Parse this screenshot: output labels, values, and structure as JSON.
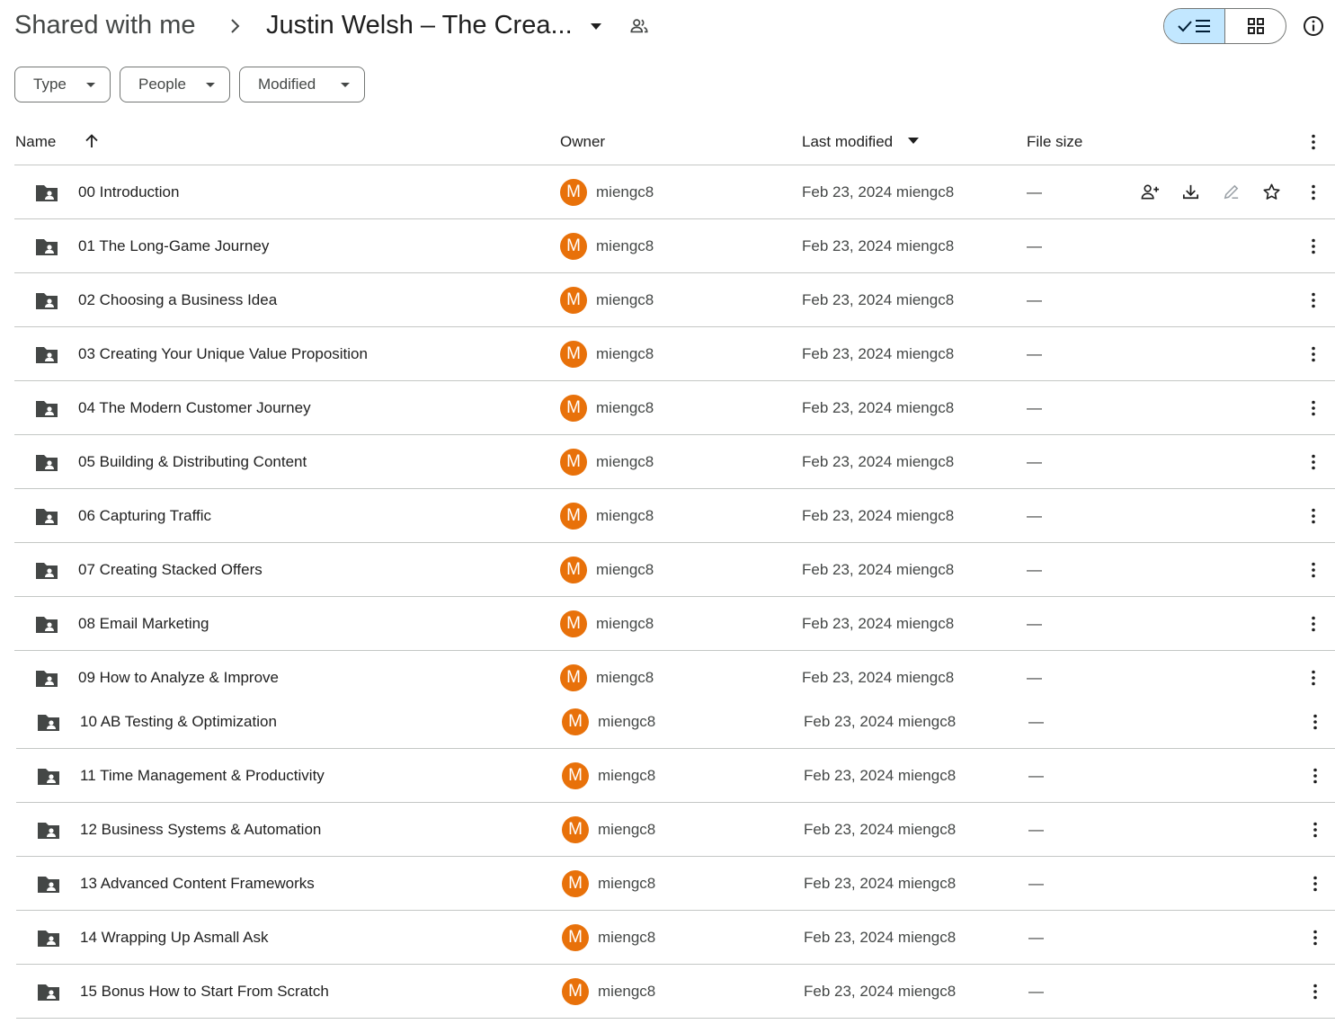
{
  "breadcrumb": {
    "root": "Shared with me",
    "current": "Justin Welsh – The Crea..."
  },
  "filters": [
    {
      "label": "Type"
    },
    {
      "label": "People"
    },
    {
      "label": "Modified"
    }
  ],
  "columns": {
    "name": "Name",
    "owner": "Owner",
    "last_modified": "Last modified",
    "file_size": "File size"
  },
  "accent": {
    "avatar": "#e8710a",
    "selected_view": "#c2e7ff"
  },
  "rows": [
    {
      "name": "00 Introduction",
      "avatar": "M",
      "owner": "miengc8",
      "modified": "Feb 23, 2024 miengc8",
      "size": "—"
    },
    {
      "name": "01 The Long-Game Journey",
      "avatar": "M",
      "owner": "miengc8",
      "modified": "Feb 23, 2024 miengc8",
      "size": "—"
    },
    {
      "name": "02 Choosing a Business Idea",
      "avatar": "M",
      "owner": "miengc8",
      "modified": "Feb 23, 2024 miengc8",
      "size": "—"
    },
    {
      "name": "03 Creating Your Unique Value Proposition",
      "avatar": "M",
      "owner": "miengc8",
      "modified": "Feb 23, 2024 miengc8",
      "size": "—"
    },
    {
      "name": "04 The Modern Customer Journey",
      "avatar": "M",
      "owner": "miengc8",
      "modified": "Feb 23, 2024 miengc8",
      "size": "—"
    },
    {
      "name": "05 Building & Distributing Content",
      "avatar": "M",
      "owner": "miengc8",
      "modified": "Feb 23, 2024 miengc8",
      "size": "—"
    },
    {
      "name": "06 Capturing Traffic",
      "avatar": "M",
      "owner": "miengc8",
      "modified": "Feb 23, 2024 miengc8",
      "size": "—"
    },
    {
      "name": "07 Creating Stacked Offers",
      "avatar": "M",
      "owner": "miengc8",
      "modified": "Feb 23, 2024 miengc8",
      "size": "—"
    },
    {
      "name": "08 Email Marketing",
      "avatar": "M",
      "owner": "miengc8",
      "modified": "Feb 23, 2024 miengc8",
      "size": "—"
    },
    {
      "name": "09 How to Analyze & Improve",
      "avatar": "M",
      "owner": "miengc8",
      "modified": "Feb 23, 2024 miengc8",
      "size": "—"
    },
    {
      "name": "10 AB Testing & Optimization",
      "avatar": "M",
      "owner": "miengc8",
      "modified": "Feb 23, 2024 miengc8",
      "size": "—"
    },
    {
      "name": "11 Time Management & Productivity",
      "avatar": "M",
      "owner": "miengc8",
      "modified": "Feb 23, 2024 miengc8",
      "size": "—"
    },
    {
      "name": "12 Business Systems & Automation",
      "avatar": "M",
      "owner": "miengc8",
      "modified": "Feb 23, 2024 miengc8",
      "size": "—"
    },
    {
      "name": "13 Advanced Content Frameworks",
      "avatar": "M",
      "owner": "miengc8",
      "modified": "Feb 23, 2024 miengc8",
      "size": "—"
    },
    {
      "name": "14 Wrapping Up Asmall Ask",
      "avatar": "M",
      "owner": "miengc8",
      "modified": "Feb 23, 2024 miengc8",
      "size": "—"
    },
    {
      "name": "15 Bonus How to Start From Scratch",
      "avatar": "M",
      "owner": "miengc8",
      "modified": "Feb 23, 2024 miengc8",
      "size": "—"
    }
  ]
}
